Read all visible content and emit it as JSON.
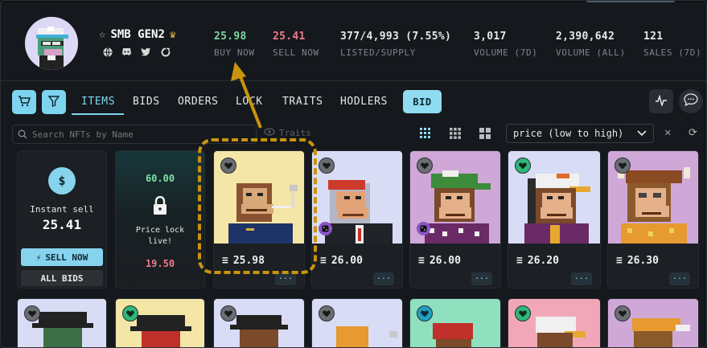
{
  "collection": {
    "name": "SMB GEN2",
    "socials": [
      "globe-icon",
      "discord-icon",
      "twitter-icon",
      "link-icon"
    ]
  },
  "stats": [
    {
      "value": "25.98",
      "label": "BUY NOW",
      "color": "green"
    },
    {
      "value": "25.41",
      "label": "SELL NOW",
      "color": "red"
    },
    {
      "value": "377/4,993 (7.55%)",
      "label": "LISTED/SUPPLY",
      "color": "white"
    },
    {
      "value": "3,017",
      "label": "VOLUME (7D)",
      "color": "white"
    },
    {
      "value": "2,390,642",
      "label": "VOLUME (ALL)",
      "color": "white"
    },
    {
      "value": "121",
      "label": "SALES (7D)",
      "color": "white"
    }
  ],
  "tabs": [
    "ITEMS",
    "BIDS",
    "ORDERS",
    "LOCK",
    "TRAITS",
    "HODLERS"
  ],
  "bid_button": "BID",
  "search": {
    "placeholder": "Search NFTs by Name"
  },
  "traits_label": "Traits",
  "sort": {
    "selected": "price (low to high)"
  },
  "instant_sell": {
    "label": "Instant sell",
    "value": "25.41",
    "sell_now": "SELL NOW",
    "all_bids": "ALL BIDS"
  },
  "price_lock": {
    "top": "60.00",
    "text_line1": "Price lock",
    "text_line2": "live!",
    "bottom": "19.50"
  },
  "listings": [
    {
      "price": "25.98",
      "more": "...",
      "bg": "#f4e6a6"
    },
    {
      "price": "26.00",
      "more": "...",
      "bg": "#d9dcf5"
    },
    {
      "price": "26.00",
      "more": "...",
      "bg": "#cfa8d8"
    },
    {
      "price": "26.20",
      "more": "...",
      "bg": "#d9dcf5"
    },
    {
      "price": "26.30",
      "more": "...",
      "bg": "#cfa8d8"
    }
  ],
  "second_row_bgs": [
    "#d9dcf5",
    "#f4e6a6",
    "#d9dcf5",
    "#d9dcf5",
    "#8fe0bf",
    "#f2a7b8",
    "#cfa8d8"
  ],
  "colors": {
    "accent": "#7fd6ef",
    "buy": "#7dd7a4",
    "sell": "#f07a8a",
    "highlight": "#c9940d"
  }
}
